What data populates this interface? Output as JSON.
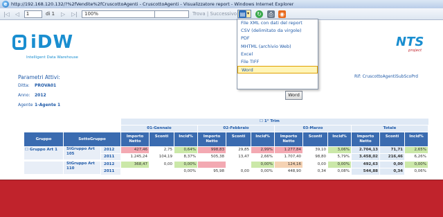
{
  "window": {
    "title": "http://192.168.120.132/?%2fVendite%2fCruscottoAgenti - CruscottoAgenti - Visualizzatore report - Windows Internet Explorer"
  },
  "toolbar": {
    "first": "|◁",
    "prev": "◁",
    "page": "1",
    "of_label": "di 1",
    "next": "▷",
    "last": "▷|",
    "zoom": "100%",
    "find_label": "Trova | Successivo",
    "icons": [
      "export-icon",
      "refresh-icon",
      "print-icon",
      "atom-feed-icon"
    ]
  },
  "export_menu": {
    "items": [
      "File XML con dati del report",
      "CSV (delimitato da virgole)",
      "PDF",
      "MHTML (archivio Web)",
      "Excel",
      "File TIFF",
      "Word"
    ],
    "active_index": 6
  },
  "header": {
    "logo_text": "iDW",
    "logo_sub": "Intelligent Data Warehouse",
    "nts_logo": "NTS",
    "nts_sub": "project"
  },
  "params": {
    "title": "Parametri Attivi:",
    "ditta_label": "Ditta:",
    "ditta_value": "PROVA01",
    "anno_label": "Anno:",
    "anno_value": "2012",
    "agente_label": "Agente",
    "agente_value": "1-Agente 1",
    "report_ref": "Rif: CruscottoAgentiSubScoPrd"
  },
  "word_button": "Word",
  "table": {
    "trimestre": "1° Trim",
    "months": [
      "01-Gennaio",
      "02-Febbraio",
      "03-Marzo",
      "Totale"
    ],
    "col_gruppo": "Gruppo",
    "col_sottogruppo": "SottoGruppo",
    "metric_headers": [
      "Importo Netto",
      "Sconti",
      "Incid%"
    ],
    "rows": [
      {
        "gruppo": "Gruppo Art 1",
        "sottogruppo": "StGruppo Art 105",
        "years": [
          {
            "year": "2012",
            "values": [
              "427,46",
              "2,75",
              "0,64%",
              "998,83",
              "29,85",
              "2,99%",
              "1.277,84",
              "39,10",
              "3,06%",
              "2.704,13",
              "71,71",
              "2,65%"
            ]
          },
          {
            "year": "2011",
            "values": [
              "1.245,24",
              "104,19",
              "8,37%",
              "505,38",
              "13,47",
              "2,66%",
              "1.707,40",
              "98,80",
              "5,79%",
              "3.458,02",
              "216,46",
              "6,26%"
            ]
          }
        ]
      },
      {
        "gruppo": "",
        "sottogruppo": "StGruppo Art 110",
        "years": [
          {
            "year": "2012",
            "values": [
              "368,47",
              "0,00",
              "0,00%",
              "",
              "",
              "0,00%",
              "124,16",
              "0,00",
              "0,00%",
              "492,63",
              "0,00",
              "0,00%"
            ]
          },
          {
            "year": "2011",
            "values": [
              "",
              "",
              "0,00%",
              "95,98",
              "0,00",
              "0,00%",
              "448,90",
              "0,34",
              "0,08%",
              "544,88",
              "0,34",
              "0,06%"
            ]
          }
        ]
      }
    ]
  }
}
